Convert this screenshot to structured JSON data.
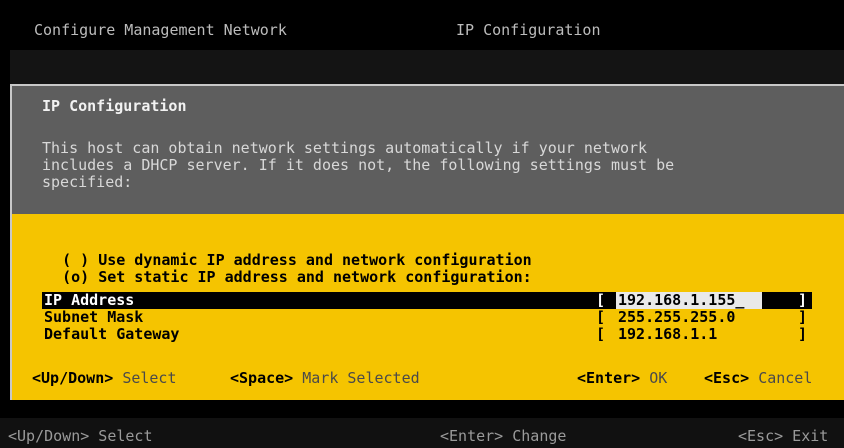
{
  "topbar": {
    "left": "Configure Management Network",
    "right": "IP Configuration"
  },
  "dialog": {
    "title": "IP Configuration",
    "description_lines": [
      "This host can obtain network settings automatically if your network",
      "includes a DHCP server. If it does not, the following settings must be",
      "specified:"
    ],
    "options": [
      {
        "marker": "( )",
        "label": "Use dynamic IP address and network configuration"
      },
      {
        "marker": "(o)",
        "label": "Set static IP address and network configuration:"
      }
    ],
    "fields": [
      {
        "label": "IP Address",
        "value": "192.168.1.155"
      },
      {
        "label": "Subnet Mask",
        "value": "255.255.255.0"
      },
      {
        "label": "Default Gateway",
        "value": "192.168.1.1"
      }
    ],
    "hints_left": [
      {
        "key": "<Up/Down>",
        "action": "Select"
      },
      {
        "key": "<Space>",
        "action": "Mark Selected"
      }
    ],
    "hints_right": [
      {
        "key": "<Enter>",
        "action": "OK"
      },
      {
        "key": "<Esc>",
        "action": "Cancel"
      }
    ]
  },
  "footer": {
    "left": "<Up/Down> Select",
    "center": "<Enter> Change",
    "right": "<Esc> Exit"
  }
}
